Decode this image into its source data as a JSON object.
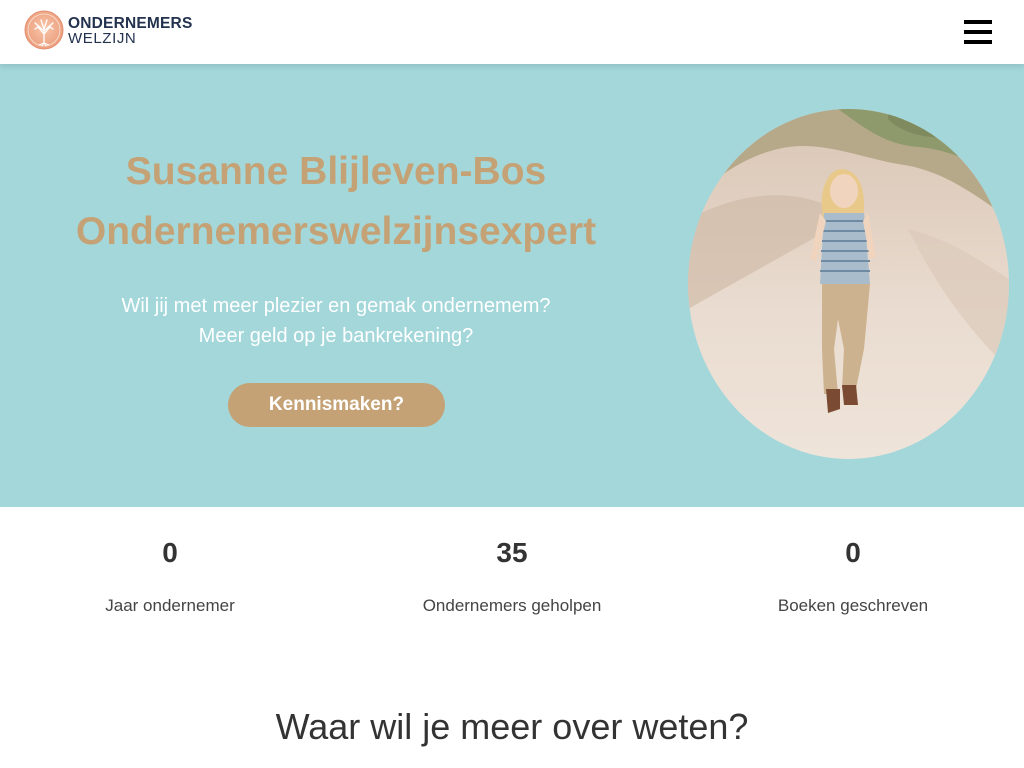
{
  "header": {
    "logo": {
      "line1": "ONDERNEMERS",
      "line2": "WELZIJN"
    },
    "menu_icon": "hamburger-menu-icon"
  },
  "hero": {
    "title_line1": "Susanne Blijleven-Bos",
    "title_line2": "Ondernemerswelzijnsexpert",
    "subtitle_line1": "Wil jij met meer plezier en gemak ondernemem?",
    "subtitle_line2": "Meer geld op je bankrekening?",
    "cta_label": "Kennismaken?"
  },
  "stats": [
    {
      "value": "0",
      "label": "Jaar ondernemer"
    },
    {
      "value": "35",
      "label": "Ondernemers geholpen"
    },
    {
      "value": "0",
      "label": "Boeken geschreven"
    }
  ],
  "section": {
    "heading": "Waar wil je meer over weten?"
  },
  "colors": {
    "hero_background": "#a3d7da",
    "accent_gold": "#c5a275",
    "logo_navy": "#23324e",
    "text_dark": "#333333"
  }
}
